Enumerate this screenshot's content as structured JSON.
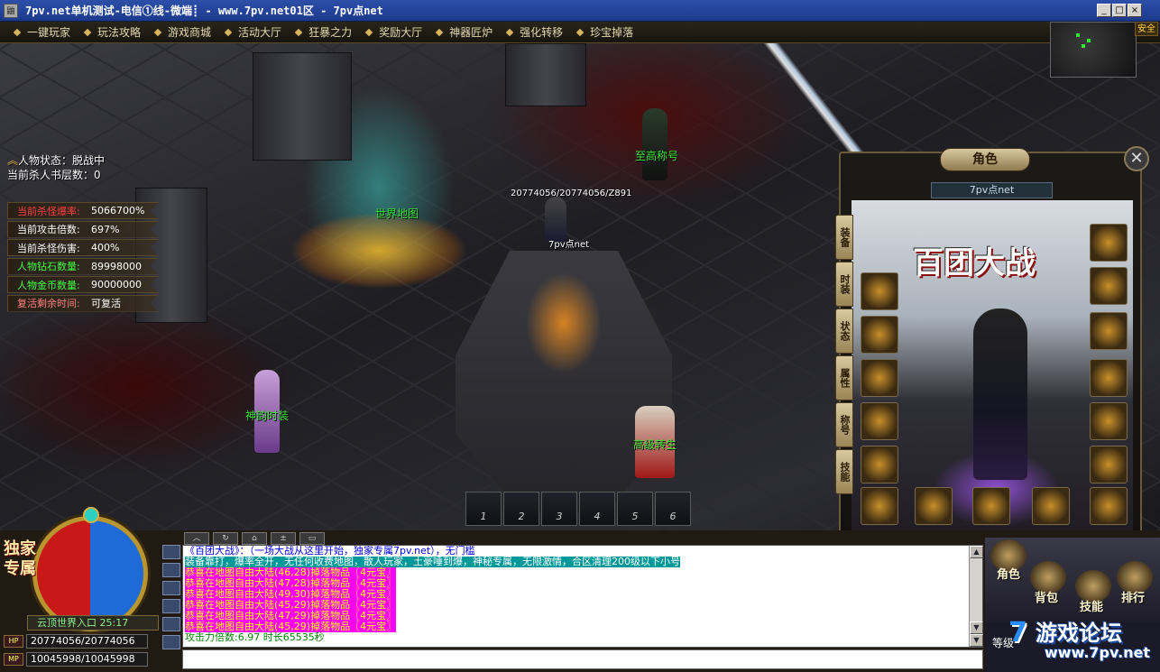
{
  "window": {
    "title": "7pv.net单机测试-电信①线-微端┋ - www.7pv.net01区 - 7pv点net",
    "minimize": "_",
    "maximize": "□",
    "close": "×"
  },
  "menu": [
    {
      "label": "一键玩家"
    },
    {
      "label": "玩法攻略"
    },
    {
      "label": "游戏商城"
    },
    {
      "label": "活动大厅"
    },
    {
      "label": "狂暴之力"
    },
    {
      "label": "奖励大厅"
    },
    {
      "label": "神器匠炉"
    },
    {
      "label": "强化转移"
    },
    {
      "label": "珍宝掉落"
    }
  ],
  "status": {
    "state": "人物状态：脱战中",
    "kill_book": "当前杀人书层数：0"
  },
  "stats": [
    {
      "label": "当前杀怪爆率:",
      "value": "5066700%",
      "color": "#ff4040"
    },
    {
      "label": "当前攻击倍数:",
      "value": "697%",
      "color": "#ffffff"
    },
    {
      "label": "当前杀怪伤害:",
      "value": "400%",
      "color": "#ffffff"
    },
    {
      "label": "人物钻石数量:",
      "value": "89998000",
      "color": "#40ff40"
    },
    {
      "label": "人物金币数量:",
      "value": "90000000",
      "color": "#40ff40"
    },
    {
      "label": "复活剩余时间:",
      "value": "可复活",
      "color": "#ff8080"
    }
  ],
  "scene": {
    "world_map_label": "世界地图",
    "top_title_label": "至高称号",
    "player_hp_label": "20774056/20774056/Z891",
    "player_name": "7pv点net",
    "npc_fashion": "神韵时装",
    "npc_transfer": "高级转生"
  },
  "safe_badge": "安全",
  "character_panel": {
    "title": "角色",
    "player_name": "7pv点net",
    "logo_text": "百团大战",
    "tabs": [
      "装备",
      "时装",
      "状态",
      "属性",
      "称号",
      "技能"
    ],
    "close": "✕"
  },
  "hotbar": [
    "1",
    "2",
    "3",
    "4",
    "5",
    "6"
  ],
  "orb": {
    "badge": "独家专属",
    "map_name": "云顶世界入口 25:17",
    "hp_tag": "HP",
    "hp": "20774056/20774056",
    "mp_tag": "MP",
    "mp": "10045998/10045998"
  },
  "chat_toolbar": [
    "︿",
    "↻",
    "⌂",
    "±",
    "▭"
  ],
  "chat": {
    "lines": [
      {
        "text": "《百团大战》：（一场大战从这里开始，独家专属7pv.net），无门槛",
        "color": "#0000ff",
        "bg": ""
      },
      {
        "text": "装备靠打，爆率全开，无任何收费地图，散人玩家，土豪唾到爆，神秘专属，无限激情，合区清理200级以下小号",
        "color": "#ffffff",
        "bg": "#009999"
      },
      {
        "text": "恭喜在地图自由大陆(46,28)掉落物品〖4元宝〗",
        "color": "#ffff00",
        "bg": "#ff00ff"
      },
      {
        "text": "恭喜在地图自由大陆(47,28)掉落物品〖4元宝〗",
        "color": "#ffff00",
        "bg": "#ff00ff"
      },
      {
        "text": "恭喜在地图自由大陆(49,30)掉落物品〖4元宝〗",
        "color": "#ffff00",
        "bg": "#ff00ff"
      },
      {
        "text": "恭喜在地图自由大陆(45,29)掉落物品〖4元宝〗",
        "color": "#ffff00",
        "bg": "#ff00ff"
      },
      {
        "text": "恭喜在地图自由大陆(47,29)掉落物品〖4元宝〗",
        "color": "#ffff00",
        "bg": "#ff00ff"
      },
      {
        "text": "恭喜在地图自由大陆(45,29)掉落物品〖4元宝〗",
        "color": "#ffff00",
        "bg": "#ff00ff"
      },
      {
        "text": "攻击力倍数:6.97 时长65535秒",
        "color": "#008000",
        "bg": ""
      }
    ]
  },
  "right_menu": {
    "role": "角色",
    "bag": "背包",
    "skill": "技能",
    "ranking": "排行"
  },
  "level": {
    "label": "等级"
  },
  "brand": {
    "num": "7",
    "name": "游戏论坛",
    "url": "www.7pv.net"
  }
}
